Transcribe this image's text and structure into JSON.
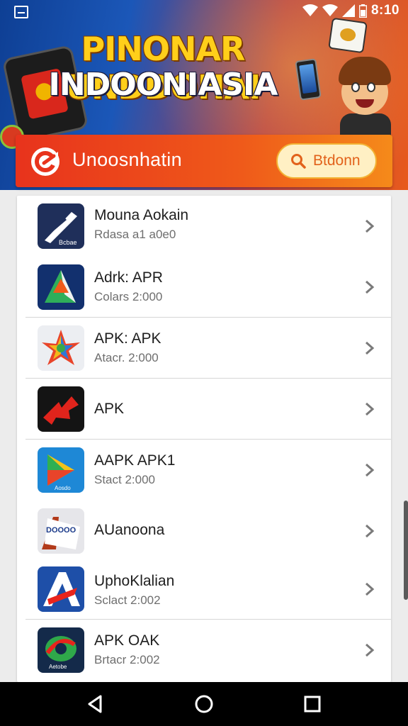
{
  "status_bar": {
    "time": "8:10",
    "icons": [
      "notification-icon",
      "wifi-icon",
      "signal-icon",
      "battery-icon"
    ]
  },
  "banner": {
    "title_line1": "PINONAR UNDDOHAI",
    "title_line2": "INDOONIASIA"
  },
  "header": {
    "title": "Unoosnhatin",
    "search_button_label": "Btdonn",
    "accent_color": "#ef4a1a"
  },
  "apps": [
    {
      "name": "Mouna Aokain",
      "subtitle": "Rdasa a1 a0e0",
      "icon": "pen-app-icon",
      "icon_label": "Bcbae"
    },
    {
      "name": "Adrk: APR",
      "subtitle": "Colars 2:000",
      "icon": "triangle-app-icon",
      "icon_label": ""
    },
    {
      "name": "APK: APK",
      "subtitle": "Atacr. 2:000",
      "icon": "star-app-icon",
      "icon_label": ""
    },
    {
      "name": "APK",
      "subtitle": "",
      "icon": "red-shape-app-icon",
      "icon_label": ""
    },
    {
      "name": "AAPK APK1",
      "subtitle": "Stact 2:000",
      "icon": "play-app-icon",
      "icon_label": "Aosdo"
    },
    {
      "name": "AUanoona",
      "subtitle": "",
      "icon": "letter-a-app-icon",
      "icon_label": "DOOOO"
    },
    {
      "name": "UphoKlalian",
      "subtitle": "Sclact 2:002",
      "icon": "blue-a-app-icon",
      "icon_label": ""
    },
    {
      "name": "APK OAK",
      "subtitle": "Brtacr 2:002",
      "icon": "globe-app-icon",
      "icon_label": "Aetobe"
    }
  ],
  "nav": {
    "buttons": [
      "back-icon",
      "home-icon",
      "recents-icon"
    ]
  }
}
